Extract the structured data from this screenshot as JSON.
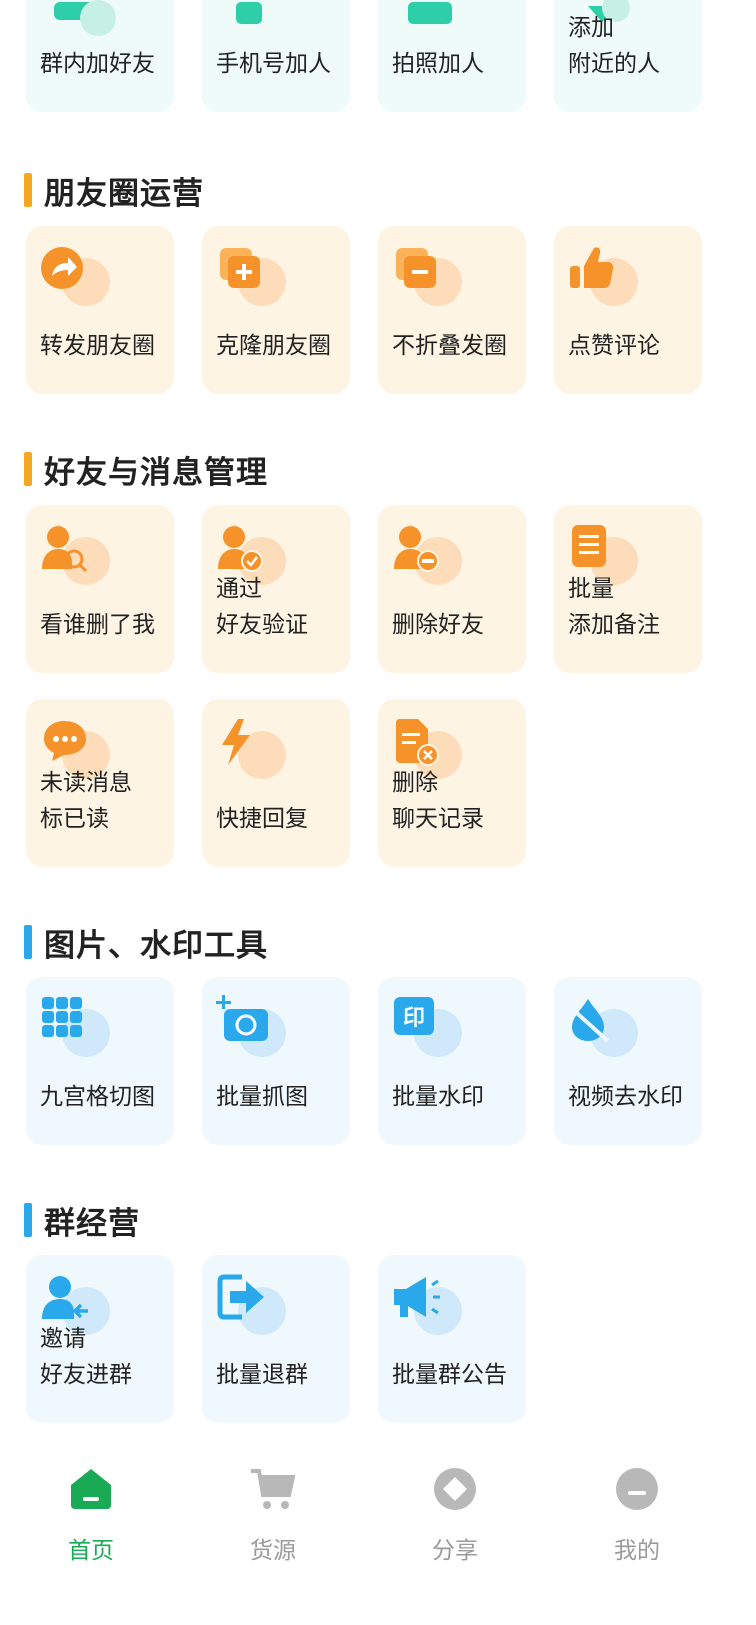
{
  "colors": {
    "orange_accent": "#f5a623",
    "blue_accent": "#29a8eb",
    "green_active": "#1aaa55",
    "tab_inactive": "#9a9a9a"
  },
  "top_row": {
    "items": [
      {
        "label": "群内加好友"
      },
      {
        "label": "手机号加人"
      },
      {
        "label": "拍照加人"
      },
      {
        "label": "添加\n附近的人"
      }
    ]
  },
  "moments": {
    "title": "朋友圈运营",
    "items": [
      {
        "label": "转发朋友圈",
        "icon": "share-arrow-icon"
      },
      {
        "label": "克隆朋友圈",
        "icon": "clone-icon"
      },
      {
        "label": "不折叠发圈",
        "icon": "no-fold-icon"
      },
      {
        "label": "点赞评论",
        "icon": "thumbs-up-icon"
      }
    ]
  },
  "friends": {
    "title": "好友与消息管理",
    "items": [
      {
        "label": "看谁删了我",
        "icon": "user-search-icon"
      },
      {
        "label": "通过\n好友验证",
        "icon": "user-check-icon"
      },
      {
        "label": "删除好友",
        "icon": "user-remove-icon"
      },
      {
        "label": "批量\n添加备注",
        "icon": "note-icon"
      },
      {
        "label": "未读消息\n标已读",
        "icon": "chat-bubble-icon"
      },
      {
        "label": "快捷回复",
        "icon": "lightning-icon"
      },
      {
        "label": "删除\n聊天记录",
        "icon": "delete-record-icon"
      }
    ]
  },
  "image_tools": {
    "title": "图片、水印工具",
    "items": [
      {
        "label": "九宫格切图",
        "icon": "grid-icon"
      },
      {
        "label": "批量抓图",
        "icon": "camera-add-icon"
      },
      {
        "label": "批量水印",
        "icon": "stamp-icon"
      },
      {
        "label": "视频去水印",
        "icon": "water-drop-icon"
      }
    ]
  },
  "group": {
    "title": "群经营",
    "items": [
      {
        "label": "邀请\n好友进群",
        "icon": "invite-user-icon"
      },
      {
        "label": "批量退群",
        "icon": "exit-icon"
      },
      {
        "label": "批量群公告",
        "icon": "megaphone-icon"
      }
    ]
  },
  "tabbar": {
    "tabs": [
      {
        "label": "首页",
        "icon": "home-icon",
        "active": true
      },
      {
        "label": "货源",
        "icon": "cart-icon",
        "active": false
      },
      {
        "label": "分享",
        "icon": "share-diamond-icon",
        "active": false
      },
      {
        "label": "我的",
        "icon": "profile-icon",
        "active": false
      }
    ]
  }
}
